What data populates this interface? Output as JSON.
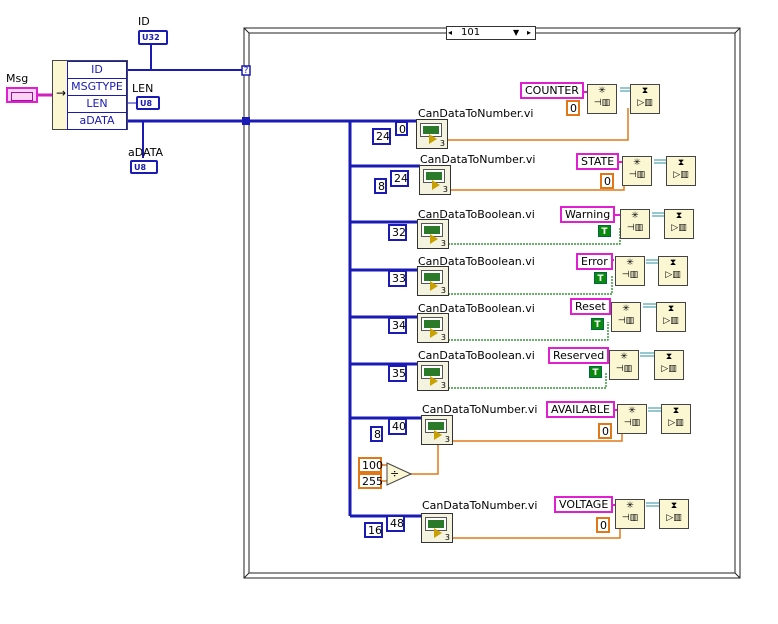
{
  "unbundle": {
    "title": "Msg",
    "fields": [
      "ID",
      "MSGTYPE",
      "LEN",
      "aDATA"
    ]
  },
  "indicators": {
    "id": {
      "label": "ID",
      "type": "U32"
    },
    "len": {
      "label": "LEN",
      "type": "U8"
    },
    "adata": {
      "label": "aDATA",
      "type": "U8"
    }
  },
  "case_selector": "101",
  "case_terminal": "?",
  "rows": [
    {
      "vi": "CanDataToNumber.vi",
      "start": "24",
      "len": "0",
      "tag": "COUNTER",
      "default": "0",
      "kind": "number"
    },
    {
      "vi": "CanDataToNumber.vi",
      "start": "24",
      "len": "8",
      "tag": "STATE",
      "default": "0",
      "kind": "number"
    },
    {
      "vi": "CanDataToBoolean.vi",
      "start": "32",
      "tag": "Warning",
      "default": "T",
      "kind": "bool"
    },
    {
      "vi": "CanDataToBoolean.vi",
      "start": "33",
      "tag": "Error",
      "default": "T",
      "kind": "bool"
    },
    {
      "vi": "CanDataToBoolean.vi",
      "start": "34",
      "tag": "Reset",
      "default": "T",
      "kind": "bool"
    },
    {
      "vi": "CanDataToBoolean.vi",
      "start": "35",
      "tag": "Reserved",
      "default": "T",
      "kind": "bool"
    },
    {
      "vi": "CanDataToNumber.vi",
      "start": "40",
      "len": "8",
      "tag": "AVAILABLE",
      "default": "0",
      "kind": "number"
    },
    {
      "vi": "CanDataToNumber.vi",
      "start": "48",
      "len": "16",
      "tag": "VOLTAGE",
      "default": "0",
      "kind": "number"
    }
  ],
  "divide": {
    "numerator": "100",
    "denominator": "255",
    "symbol": "÷"
  },
  "subvi_terminal_count": "3"
}
